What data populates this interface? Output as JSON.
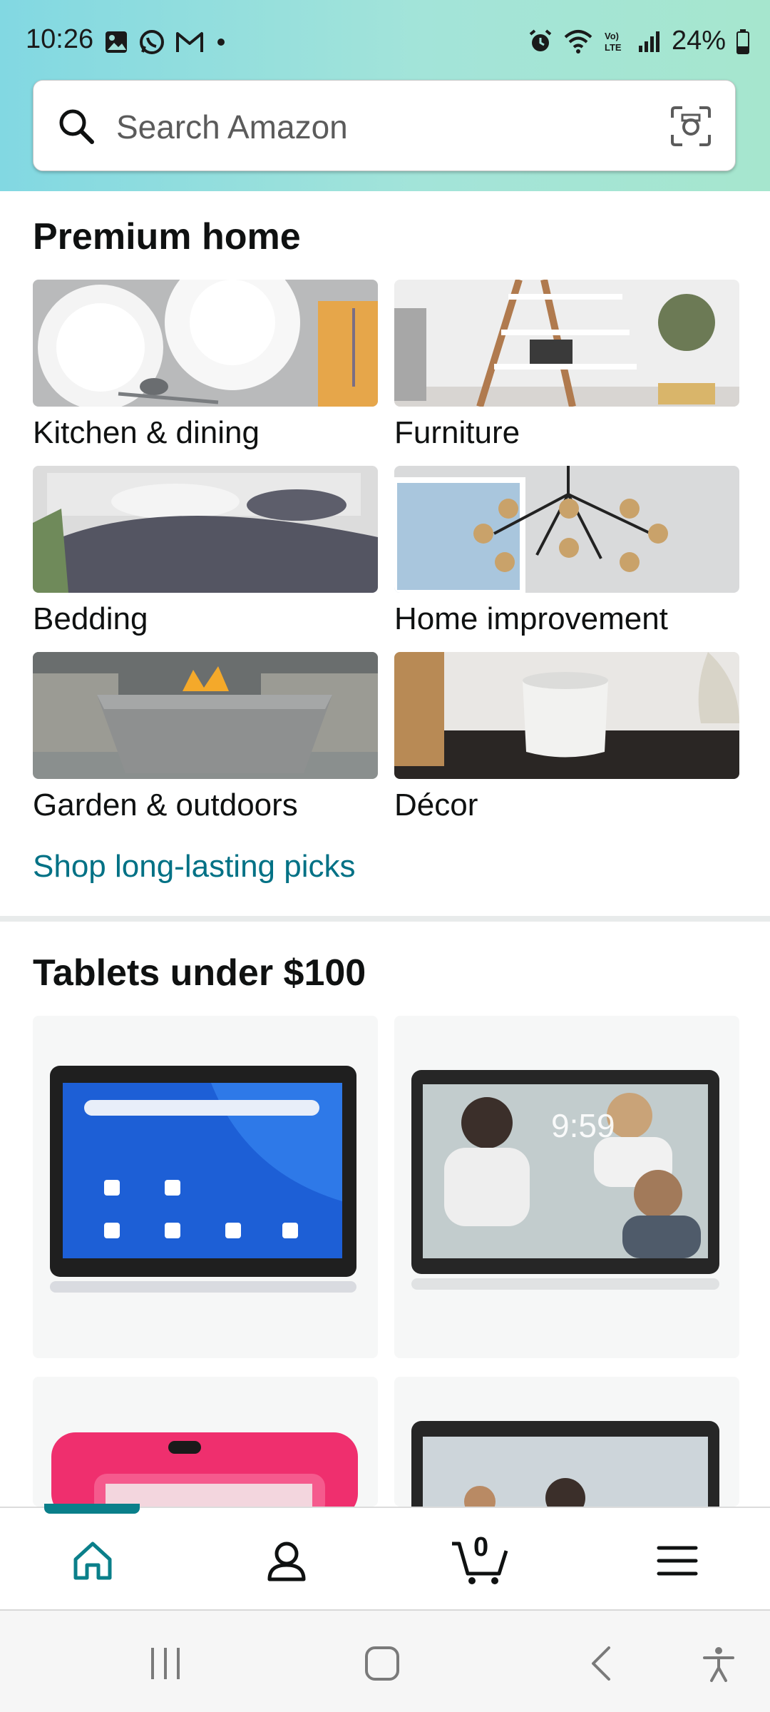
{
  "status_bar": {
    "time": "10:26",
    "battery": "24%"
  },
  "search": {
    "placeholder": "Search Amazon"
  },
  "premium_home": {
    "title": "Premium home",
    "tiles": [
      {
        "label": "Kitchen & dining"
      },
      {
        "label": "Furniture"
      },
      {
        "label": "Bedding"
      },
      {
        "label": "Home improvement"
      },
      {
        "label": "Garden & outdoors"
      },
      {
        "label": "Décor"
      }
    ],
    "link": "Shop long-lasting picks"
  },
  "tablets": {
    "title": "Tablets under $100",
    "screen_text": "9:59"
  },
  "bottom_nav": {
    "items": [
      "home-icon",
      "account-icon",
      "cart-icon",
      "menu-icon"
    ],
    "cart_count": "0",
    "accent": "#0a7f8a"
  },
  "colors": {
    "link": "#007185",
    "header_start": "#82d8e2",
    "header_end": "#a6e6ce"
  }
}
